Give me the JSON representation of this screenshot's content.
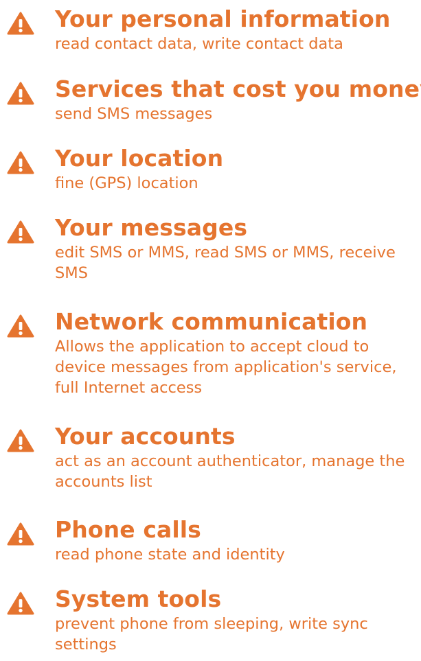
{
  "theme": {
    "accent_color": "#E5742F"
  },
  "permissions": [
    {
      "icon": "warning-icon",
      "title": "Your personal information",
      "description": "read contact data, write contact data"
    },
    {
      "icon": "warning-icon",
      "title": "Services that cost you money",
      "description": "send SMS messages"
    },
    {
      "icon": "warning-icon",
      "title": "Your location",
      "description": "fine (GPS) location"
    },
    {
      "icon": "warning-icon",
      "title": "Your messages",
      "description": "edit SMS or MMS, read SMS or MMS, receive SMS"
    },
    {
      "icon": "warning-icon",
      "title": "Network communication",
      "description": "Allows the application to accept cloud to device messages from application's service, full Internet access"
    },
    {
      "icon": "warning-icon",
      "title": "Your accounts",
      "description": "act as an account authenticator, manage the accounts list"
    },
    {
      "icon": "warning-icon",
      "title": "Phone calls",
      "description": "read phone state and identity"
    },
    {
      "icon": "warning-icon",
      "title": "System tools",
      "description": "prevent phone from sleeping, write sync settings"
    }
  ]
}
